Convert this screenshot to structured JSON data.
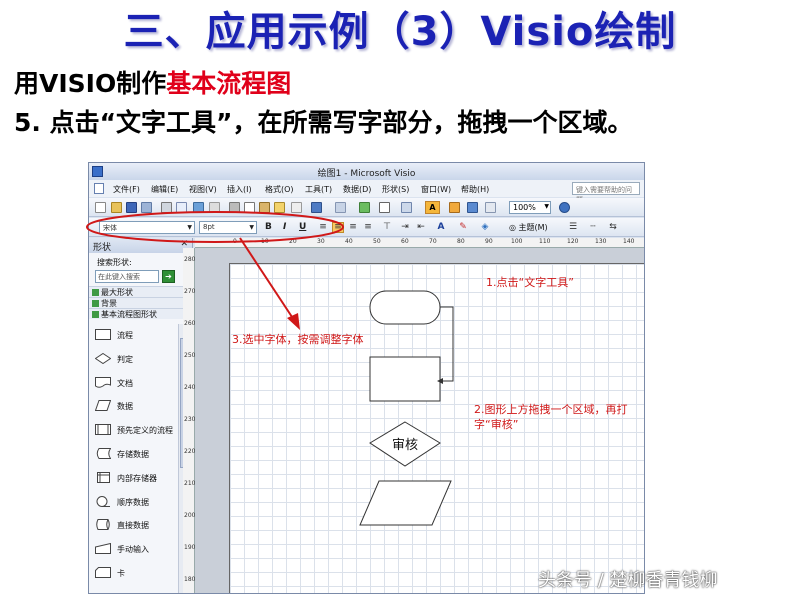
{
  "slide": {
    "title": "三、应用示例（3）Visio绘制",
    "subtitle_prefix": "用VISIO制作",
    "subtitle_highlight": "基本流程图",
    "step_text": "5. 点击“文字工具”，在所需写字部分，拖拽一个区域。"
  },
  "window": {
    "title": "绘图1 - Microsoft Visio",
    "help_placeholder": "键入需要帮助的问题"
  },
  "menu": [
    "文件(F)",
    "编辑(E)",
    "视图(V)",
    "插入(I)",
    "格式(O)",
    "工具(T)",
    "数据(D)",
    "形状(S)",
    "窗口(W)",
    "帮助(H)"
  ],
  "toolbar": {
    "zoom": "100%",
    "font_name": "宋体",
    "font_size": "8pt",
    "bold": "B",
    "italic": "I",
    "underline": "U",
    "theme_label": "主题(M)"
  },
  "shapes_panel": {
    "title": "形状",
    "search_label": "搜索形状:",
    "search_placeholder": "在此键入搜索",
    "stencils": [
      "最大形状",
      "背景",
      "基本流程图形状"
    ],
    "shapes": [
      "流程",
      "判定",
      "文档",
      "数据",
      "预先定义的流程",
      "存储数据",
      "内部存储器",
      "顺序数据",
      "直接数据",
      "手动输入",
      "卡"
    ]
  },
  "ruler": {
    "top": [
      "0",
      "10",
      "20",
      "30",
      "40",
      "50",
      "60",
      "70",
      "80",
      "90",
      "100",
      "110",
      "120",
      "130",
      "140"
    ],
    "left": [
      "280",
      "270",
      "260",
      "250",
      "240",
      "230",
      "220",
      "210",
      "200",
      "190",
      "180"
    ]
  },
  "diagram": {
    "decision_text": "审核"
  },
  "annotations": {
    "a1": "1.点击“文字工具”",
    "a2": "2.图形上方拖拽一个区域，再打字“审核”",
    "a3": "3.选中字体，按需调整字体"
  },
  "watermark": "头条号 / 楚柳香青钱柳",
  "colors": {
    "title_blue": "#1b22b4",
    "highlight_red": "#e0001a",
    "annotation_red": "#d01818"
  }
}
